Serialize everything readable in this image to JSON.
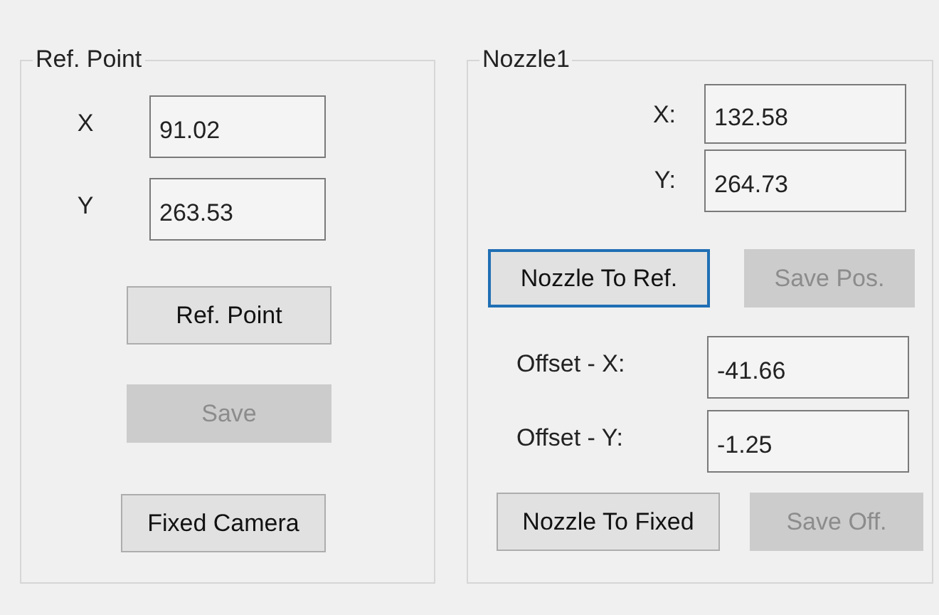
{
  "groups": [
    {
      "title": "Ref. Point",
      "rows": [
        {
          "kind": "field",
          "label": "X",
          "value": "91.02"
        },
        {
          "kind": "field",
          "label": "Y",
          "value": "263.53"
        },
        {
          "kind": "buttons",
          "buttons": [
            {
              "label": "Ref. Point",
              "disabled": false,
              "focused": false
            }
          ]
        },
        {
          "kind": "buttons",
          "buttons": [
            {
              "label": "Save",
              "disabled": true,
              "focused": false
            }
          ]
        },
        {
          "kind": "buttons",
          "buttons": [
            {
              "label": "Fixed Camera",
              "disabled": false,
              "focused": false
            }
          ]
        }
      ]
    },
    {
      "title": "Nozzle1",
      "rows": [
        {
          "kind": "field",
          "label": "X:",
          "value": "132.58"
        },
        {
          "kind": "field",
          "label": "Y:",
          "value": "264.73"
        },
        {
          "kind": "buttons",
          "buttons": [
            {
              "label": "Nozzle To Ref.",
              "disabled": false,
              "focused": true
            },
            {
              "label": "Save Pos.",
              "disabled": true,
              "focused": false
            }
          ]
        },
        {
          "kind": "field",
          "label": "Offset - X:",
          "value": "-41.66"
        },
        {
          "kind": "field",
          "label": "Offset - Y:",
          "value": "-1.25"
        },
        {
          "kind": "buttons",
          "buttons": [
            {
              "label": "Nozzle To Fixed",
              "disabled": false,
              "focused": false
            },
            {
              "label": "Save Off.",
              "disabled": true,
              "focused": false
            }
          ]
        }
      ]
    }
  ]
}
